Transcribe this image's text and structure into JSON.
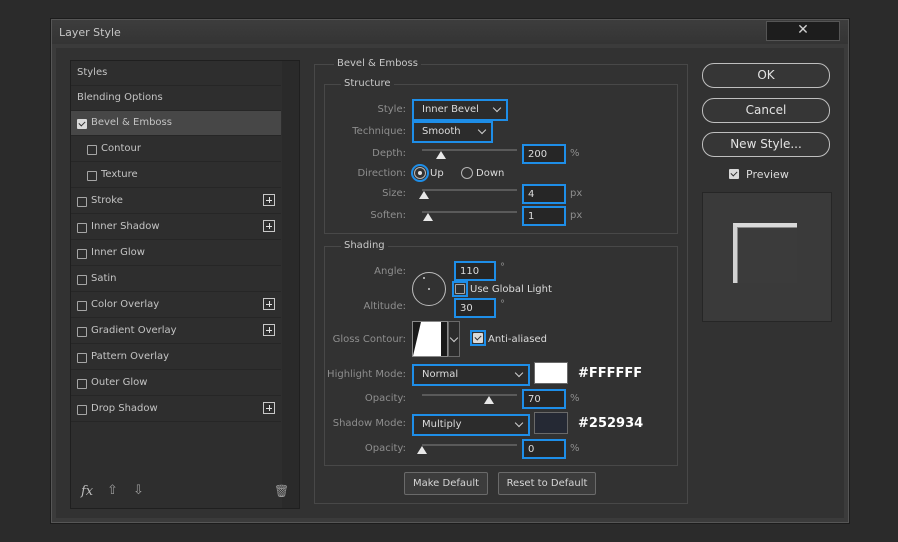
{
  "window": {
    "title": "Layer Style",
    "close_glyph": "✕"
  },
  "styles_list": {
    "header": "Styles",
    "blending": "Blending Options",
    "items": [
      {
        "label": "Bevel & Emboss",
        "checked": true,
        "selected": true
      },
      {
        "label": "Contour",
        "checked": false
      },
      {
        "label": "Texture",
        "checked": false
      },
      {
        "label": "Stroke",
        "checked": false
      },
      {
        "label": "Inner Shadow",
        "checked": false
      },
      {
        "label": "Inner Glow",
        "checked": false
      },
      {
        "label": "Satin",
        "checked": false
      },
      {
        "label": "Color Overlay",
        "checked": false
      },
      {
        "label": "Gradient Overlay",
        "checked": false
      },
      {
        "label": "Pattern Overlay",
        "checked": false
      },
      {
        "label": "Outer Glow",
        "checked": false
      },
      {
        "label": "Drop Shadow",
        "checked": false
      }
    ],
    "footer": {
      "fx": "fx",
      "up_glyph": "⇧",
      "down_glyph": "⇩",
      "trash_glyph": "🗑"
    }
  },
  "bevel": {
    "title": "Bevel & Emboss",
    "structure": {
      "title": "Structure",
      "style_label": "Style:",
      "style_value": "Inner Bevel",
      "technique_label": "Technique:",
      "technique_value": "Smooth",
      "depth_label": "Depth:",
      "depth_value": "200",
      "depth_unit": "%",
      "direction_label": "Direction:",
      "up_label": "Up",
      "down_label": "Down",
      "direction_selected": "Up",
      "size_label": "Size:",
      "size_value": "4",
      "size_unit": "px",
      "soften_label": "Soften:",
      "soften_value": "1",
      "soften_unit": "px"
    },
    "shading": {
      "title": "Shading",
      "angle_label": "Angle:",
      "angle_value": "110",
      "angle_unit": "°",
      "global_light_label": "Use Global Light",
      "global_light_checked": false,
      "altitude_label": "Altitude:",
      "altitude_value": "30",
      "altitude_unit": "°",
      "gloss_label": "Gloss Contour:",
      "anti_aliased_label": "Anti-aliased",
      "anti_aliased_checked": true,
      "highlight_label": "Highlight Mode:",
      "highlight_value": "Normal",
      "highlight_color": "#FFFFFF",
      "highlight_opacity_label": "Opacity:",
      "highlight_opacity_value": "70",
      "highlight_opacity_unit": "%",
      "shadow_label": "Shadow Mode:",
      "shadow_value": "Multiply",
      "shadow_color": "#252934",
      "shadow_opacity_label": "Opacity:",
      "shadow_opacity_value": "0",
      "shadow_opacity_unit": "%"
    },
    "make_default": "Make Default",
    "reset_default": "Reset to Default"
  },
  "actions": {
    "ok": "OK",
    "cancel": "Cancel",
    "new_style": "New Style...",
    "preview_label": "Preview",
    "preview_checked": true
  }
}
